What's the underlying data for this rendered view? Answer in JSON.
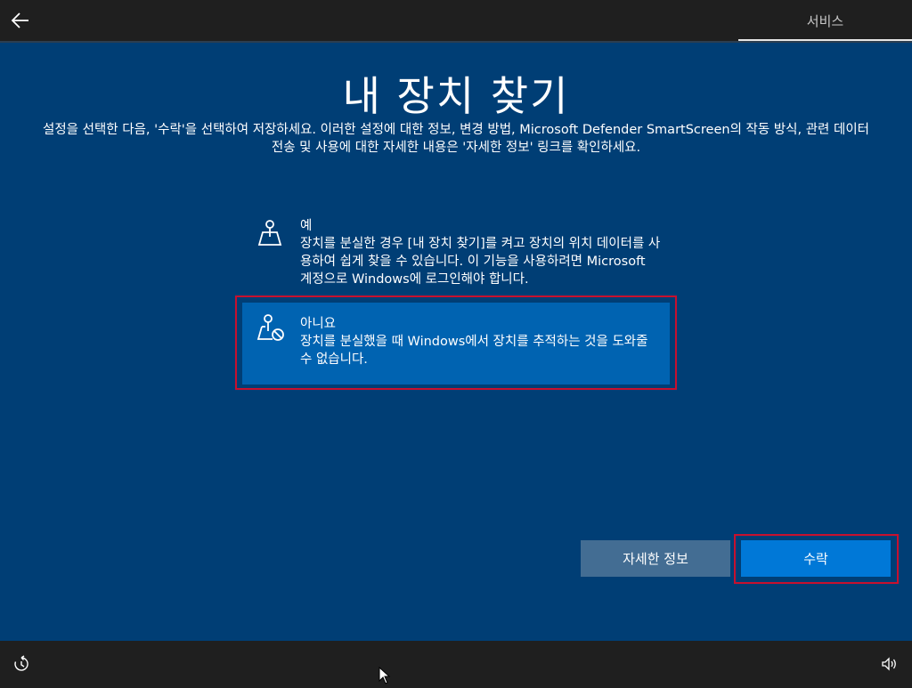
{
  "header": {
    "back_icon": "back-arrow-icon",
    "tab_label": "서비스"
  },
  "main": {
    "title": "내 장치 찾기",
    "description": "설정을 선택한 다음, '수락'을 선택하여 저장하세요. 이러한 설정에 대한 정보, 변경 방법, Microsoft Defender SmartScreen의 작동 방식, 관련 데이터 전송 및 사용에 대한 자세한 내용은 '자세한 정보' 링크를 확인하세요.",
    "options": [
      {
        "icon": "location-map-icon",
        "title": "예",
        "body": "장치를 분실한 경우 [내 장치 찾기]를 켜고 장치의 위치 데이터를 사용하여 쉽게 찾을 수 있습니다. 이 기능을 사용하려면 Microsoft 계정으로 Windows에 로그인해야 합니다."
      },
      {
        "icon": "location-map-blocked-icon",
        "title": "아니요",
        "body": "장치를 분실했을 때 Windows에서 장치를 추적하는 것을 도와줄 수 없습니다.",
        "selected": true
      }
    ]
  },
  "buttons": {
    "more_info": "자세한 정보",
    "accept": "수락"
  },
  "taskbar": {
    "ease_icon": "ease-of-access-icon",
    "volume_icon": "volume-icon"
  },
  "colors": {
    "background": "#003e75",
    "selected_option": "#0063b1",
    "accent_button": "#0078d7",
    "secondary_button": "#436d93",
    "highlight_border": "#c8102e"
  }
}
